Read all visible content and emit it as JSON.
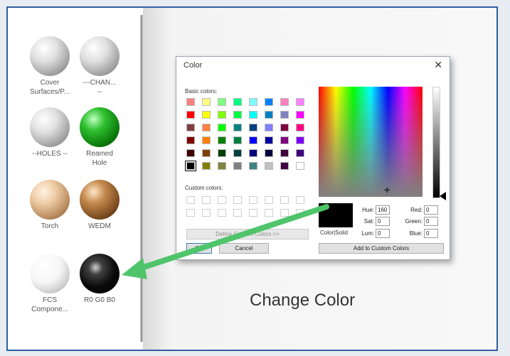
{
  "materials": [
    {
      "label": "Cover\nSurfaces/P...",
      "style": "white"
    },
    {
      "label": "---CHAN...\n--",
      "style": "white"
    },
    {
      "label": "--HOLES --",
      "style": "white"
    },
    {
      "label": "Reamed\nHole",
      "style": "green"
    },
    {
      "label": "Torch",
      "style": "peach"
    },
    {
      "label": "WEDM",
      "style": "copper"
    },
    {
      "label": "FCS\nCompone...",
      "style": "bright"
    },
    {
      "label": "R0 G0 B0",
      "style": "black"
    }
  ],
  "dialog": {
    "title": "Color",
    "close": "✕",
    "basic_colors_label": "Basic colors:",
    "custom_colors_label": "Custom colors:",
    "define_custom_button": "Define Custom Colors >>",
    "ok_button": "OK",
    "cancel_button": "Cancel",
    "add_custom_button": "Add to Custom Colors",
    "color_solid_label": "Color|Solid",
    "hue_label": "Hue:",
    "hue_value": "160",
    "sat_label": "Sat:",
    "sat_value": "0",
    "lum_label": "Lum:",
    "lum_value": "0",
    "red_label": "Red:",
    "red_value": "0",
    "green_label": "Green:",
    "green_value": "0",
    "blue_label": "Blue:",
    "blue_value": "0",
    "basic_colors": [
      [
        "#ff8080",
        "#ffff80",
        "#80ff80",
        "#00ff80",
        "#80ffff",
        "#0080ff",
        "#ff80c0",
        "#ff80ff"
      ],
      [
        "#ff0000",
        "#ffff00",
        "#80ff00",
        "#00ff40",
        "#00ffff",
        "#0080c0",
        "#8080c0",
        "#ff00ff"
      ],
      [
        "#804040",
        "#ff8040",
        "#00ff00",
        "#008080",
        "#004080",
        "#8080ff",
        "#800040",
        "#ff0080"
      ],
      [
        "#800000",
        "#ff8000",
        "#008000",
        "#008040",
        "#0000ff",
        "#0000a0",
        "#800080",
        "#8000ff"
      ],
      [
        "#400000",
        "#804000",
        "#004000",
        "#004040",
        "#000080",
        "#000040",
        "#400040",
        "#400080"
      ],
      [
        "#000000",
        "#808000",
        "#808040",
        "#808080",
        "#408080",
        "#c0c0c0",
        "#400040",
        "#ffffff"
      ]
    ]
  },
  "caption": "Change Color",
  "colors": {
    "frame_border": "#2f5f9f",
    "arrow": "#4fc46a"
  }
}
